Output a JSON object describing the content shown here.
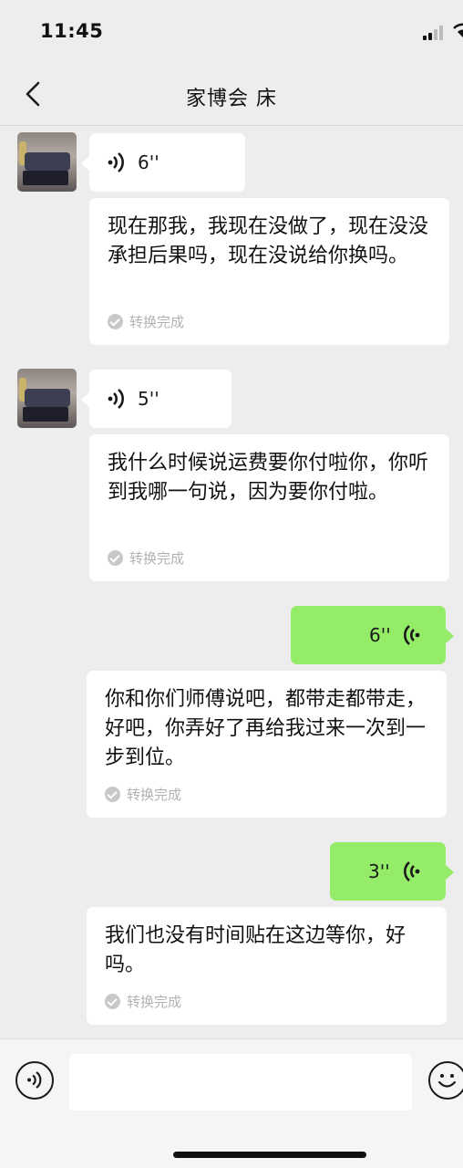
{
  "status_bar": {
    "time": "11:45"
  },
  "header": {
    "title": "家博会 床"
  },
  "messages": [
    {
      "sender": "contact",
      "duration": "6''",
      "transcript": "现在那我，我现在没做了，现在没没承担后果吗，现在没说给你换吗。",
      "status": "转换完成"
    },
    {
      "sender": "contact",
      "duration": "5''",
      "transcript": "我什么时候说运费要你付啦你，你听到我哪一句说，因为要你付啦。",
      "status": "转换完成"
    },
    {
      "sender": "me",
      "duration": "6''",
      "transcript": "你和你们师傅说吧，都带走都带走，好吧，你弄好了再给我过来一次到一步到位。",
      "status": "转换完成"
    },
    {
      "sender": "me",
      "duration": "3''",
      "transcript": "我们也没有时间贴在这边等你，好吗。",
      "status": "转换完成"
    }
  ],
  "input_bar": {
    "value": "",
    "placeholder": ""
  },
  "icons": {
    "back": "chevron-left-icon",
    "voice_message": "sound-wave-icon",
    "voice_toggle": "voice-mode-icon",
    "emoji": "smiley-face-icon",
    "check": "check-circle-icon"
  },
  "colors": {
    "background": "#ededed",
    "my_bubble": "#95ec69",
    "their_bubble": "#ffffff",
    "status_text": "#b2b2b2"
  }
}
